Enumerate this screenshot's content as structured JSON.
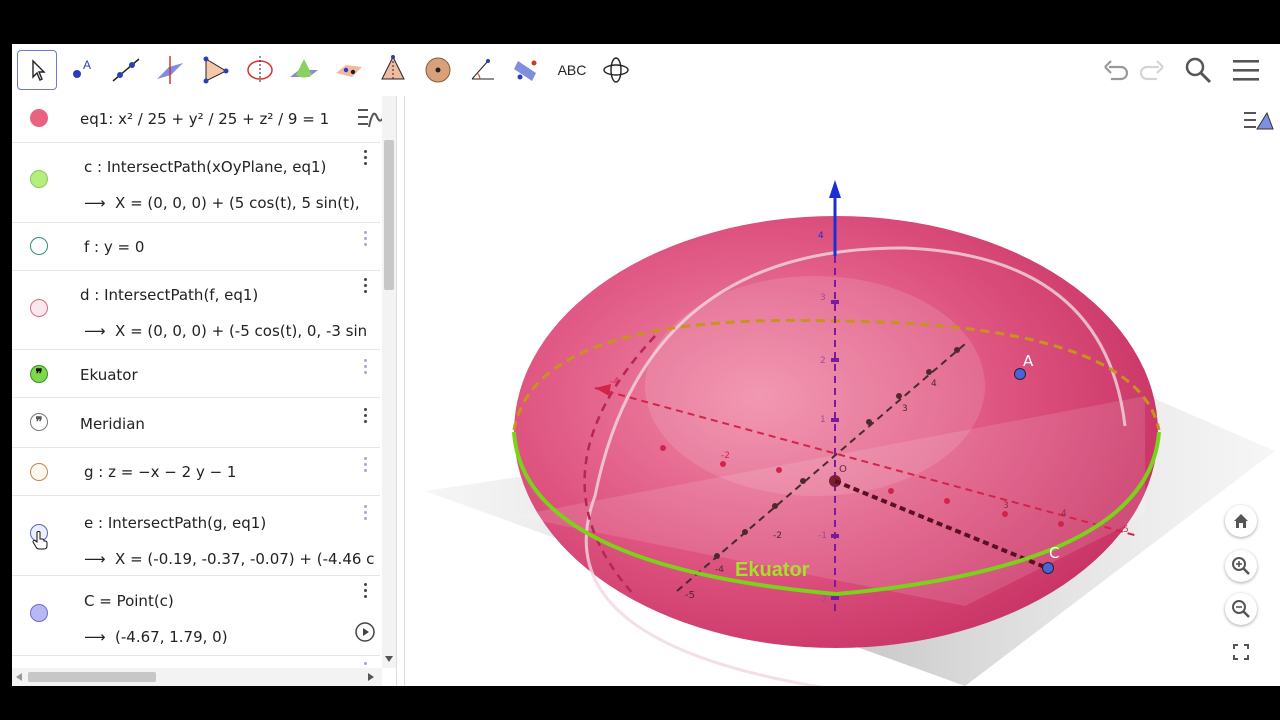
{
  "toolbar": {
    "tools": [
      {
        "name": "move-tool-icon"
      },
      {
        "name": "point-tool-icon",
        "label": "A"
      },
      {
        "name": "line-tool-icon"
      },
      {
        "name": "perpendicular-line-tool-icon"
      },
      {
        "name": "polygon-tool-icon"
      },
      {
        "name": "circle-axis-tool-icon"
      },
      {
        "name": "plane-tool-icon"
      },
      {
        "name": "pyramid-tool-icon"
      },
      {
        "name": "cone-tool-icon"
      },
      {
        "name": "sphere-tool-icon"
      },
      {
        "name": "angle-tool-icon"
      },
      {
        "name": "reflect-tool-icon"
      },
      {
        "name": "text-tool-icon",
        "label": "ABC"
      },
      {
        "name": "rotate-view-tool-icon"
      }
    ],
    "right": [
      "undo-icon",
      "redo-icon",
      "search-icon",
      "menu-icon"
    ]
  },
  "algebra": {
    "rows": [
      {
        "def": "eq1: x² / 25 + y² / 25 + z² / 9 = 1",
        "marble": "#e8637f"
      },
      {
        "def": "c : IntersectPath(xOyPlane, eq1)",
        "value": "X = (0, 0, 0) + (5 cos(t), 5 sin(t),",
        "marble": "#b4ee7c"
      },
      {
        "def": "f : y = 0",
        "marble": "#d8f1ed"
      },
      {
        "def": "d : IntersectPath(f, eq1)",
        "value": "X = (0, 0, 0) + (-5 cos(t), 0, -3 sin",
        "marble": "#f6d4dc"
      },
      {
        "def": "Ekuator",
        "marble": "quote"
      },
      {
        "def": "Meridian",
        "marble": "quote"
      },
      {
        "def": "g : z = −x − 2 y − 1",
        "marble": "#fff8ef"
      },
      {
        "def": "e : IntersectPath(g, eq1)",
        "value": "X = (-0.19, -0.37, -0.07) + (-4.46 c",
        "marble": "#eef0ff"
      },
      {
        "def": "C = Point(c)",
        "value": "(-4.67, 1.79, 0)",
        "marble": "#b8b8f6"
      }
    ]
  },
  "graphics": {
    "point_labels": {
      "A": "A",
      "C": "C"
    },
    "ekuator_label": "Ekuator",
    "z_ticks": [
      "4",
      "3",
      "2",
      "1",
      "-1",
      "-2"
    ],
    "x_ticks": [
      "-4",
      "-3",
      "-2",
      "-1",
      "1",
      "2",
      "3",
      "4",
      "5"
    ],
    "y_ticks": [
      "4",
      "3",
      "2",
      "1",
      "-1",
      "-2",
      "-3",
      "-4",
      "-5"
    ],
    "origin_label": "O",
    "colors": {
      "ellipsoid": "#d23a66",
      "equator": "#7ad319",
      "axis_z": "#1a2fd6",
      "point": "#4a64d8"
    }
  },
  "view_buttons": [
    "home-icon",
    "zoom-in-icon",
    "zoom-out-icon",
    "fullscreen-icon"
  ]
}
